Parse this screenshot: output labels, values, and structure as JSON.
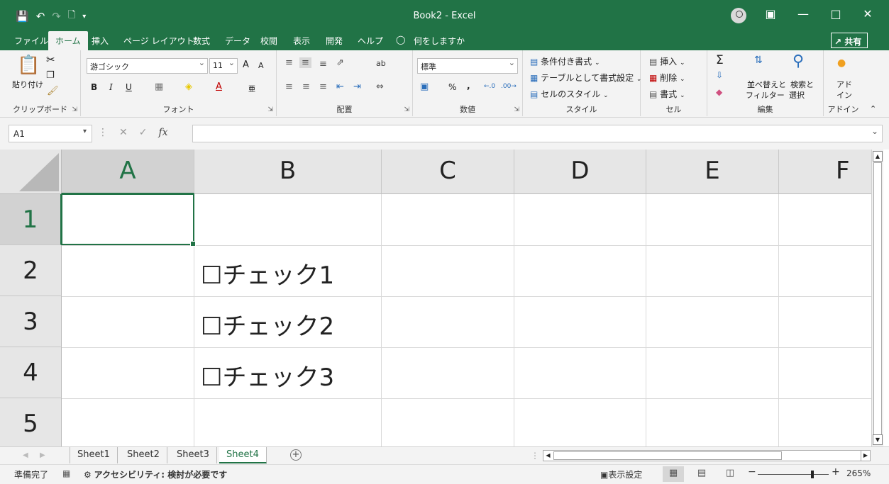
{
  "window": {
    "title": "Book2  -  Excel",
    "qat_icons": [
      "save-icon",
      "undo-icon",
      "redo-icon",
      "new-file-icon",
      "customize-qat-icon"
    ]
  },
  "tabs": [
    {
      "label": "ファイル"
    },
    {
      "label": "ホーム",
      "active": true
    },
    {
      "label": "挿入"
    },
    {
      "label": "ページ レイアウト"
    },
    {
      "label": "数式"
    },
    {
      "label": "データ"
    },
    {
      "label": "校閲"
    },
    {
      "label": "表示"
    },
    {
      "label": "開発"
    },
    {
      "label": "ヘルプ"
    },
    {
      "label": "何をしますか"
    }
  ],
  "share_label": "共有",
  "ribbon": {
    "clipboard": {
      "label": "クリップボード",
      "paste": "貼り付け"
    },
    "font": {
      "label": "フォント",
      "font_name": "游ゴシック",
      "font_size": "11",
      "bold": "B",
      "italic": "I",
      "underline": "U",
      "grow": "A",
      "shrink": "A",
      "phonetic": "亜"
    },
    "alignment": {
      "label": "配置",
      "wrap": "ab"
    },
    "number": {
      "label": "数値",
      "format": "標準",
      "percent": "%",
      "comma": ","
    },
    "styles": {
      "label": "スタイル",
      "conditional": "条件付き書式",
      "table": "テーブルとして書式設定",
      "cell_styles": "セルのスタイル"
    },
    "cells": {
      "label": "セル",
      "insert": "挿入",
      "delete": "削除",
      "format": "書式"
    },
    "editing": {
      "label": "編集",
      "sort": "並べ替えと",
      "sort2": "フィルター",
      "find": "検索と",
      "find2": "選択",
      "sigma": "Σ"
    },
    "addins": {
      "label": "アドイン",
      "btn1": "アド",
      "btn2": "イン"
    }
  },
  "formula_bar": {
    "namebox": "A1",
    "fx": "fx",
    "value": ""
  },
  "columns": [
    "A",
    "B",
    "C",
    "D",
    "E",
    "F"
  ],
  "rows": [
    "1",
    "2",
    "3",
    "4",
    "5"
  ],
  "cells": {
    "B2": "☐チェック1",
    "B3": "☐チェック2",
    "B4": "☐チェック3"
  },
  "sheets": [
    "Sheet1",
    "Sheet2",
    "Sheet3",
    "Sheet4"
  ],
  "active_sheet": "Sheet4",
  "status": {
    "ready": "準備完了",
    "accessibility": "アクセシビリティ: 検討が必要です",
    "display_settings": "表示設定",
    "zoom": "265%"
  }
}
